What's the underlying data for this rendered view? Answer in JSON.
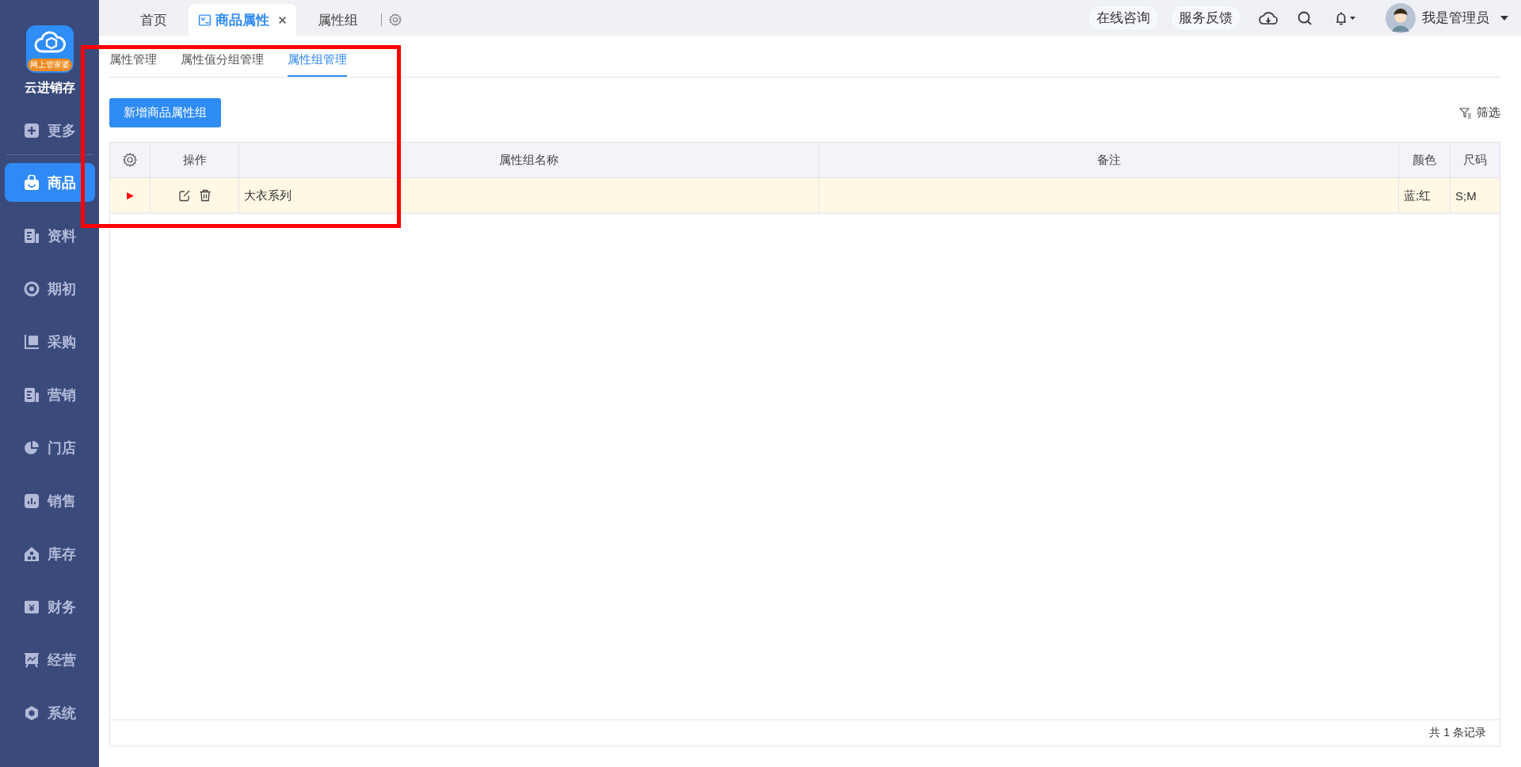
{
  "app": {
    "name": "云进销存",
    "logo_badge": "网上管家婆"
  },
  "sidebar": {
    "items": [
      {
        "label": "更多",
        "kind": "plus",
        "selected": false
      },
      {
        "label": "商品",
        "kind": "bag",
        "selected": true
      },
      {
        "label": "资料",
        "kind": "doc",
        "selected": false
      },
      {
        "label": "期初",
        "kind": "target",
        "selected": false
      },
      {
        "label": "采购",
        "kind": "cart",
        "selected": false
      },
      {
        "label": "营销",
        "kind": "doc",
        "selected": false
      },
      {
        "label": "门店",
        "kind": "pie",
        "selected": false
      },
      {
        "label": "销售",
        "kind": "bars",
        "selected": false
      },
      {
        "label": "库存",
        "kind": "house",
        "selected": false
      },
      {
        "label": "财务",
        "kind": "yen",
        "selected": false
      },
      {
        "label": "经营",
        "kind": "board",
        "selected": false
      },
      {
        "label": "系统",
        "kind": "hex",
        "selected": false
      }
    ]
  },
  "tabs": [
    {
      "label": "首页",
      "selected": false,
      "closable": false
    },
    {
      "label": "商品属性",
      "selected": true,
      "closable": true
    },
    {
      "label": "属性组",
      "selected": false,
      "closable": false
    }
  ],
  "header": {
    "buttons": [
      "在线咨询",
      "服务反馈"
    ],
    "user": "我是管理员"
  },
  "subtabs": [
    {
      "label": "属性管理",
      "selected": false
    },
    {
      "label": "属性值分组管理",
      "selected": false
    },
    {
      "label": "属性组管理",
      "selected": true
    }
  ],
  "toolbar": {
    "add_button": "新增商品属性组",
    "filter": "筛选"
  },
  "table": {
    "columns": [
      "操作",
      "属性组名称",
      "备注",
      "颜色",
      "尺码"
    ],
    "rows": [
      {
        "selected": true,
        "name": "大衣系列",
        "colors": "蓝;红",
        "sizes": "S;M"
      }
    ]
  },
  "footer": "共 1 条记录"
}
